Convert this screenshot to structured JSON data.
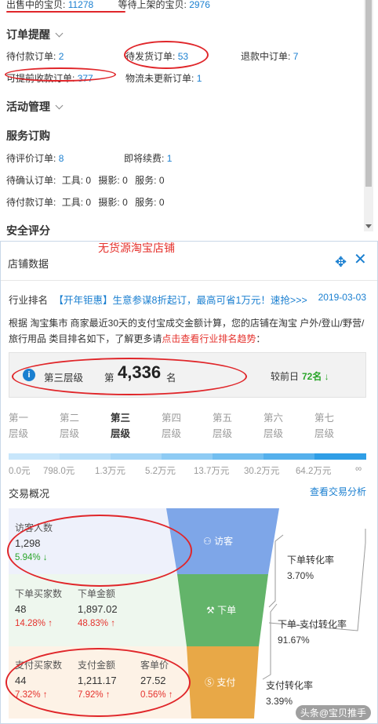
{
  "top": {
    "on_sale_label": "出售中的宝贝:",
    "on_sale_value": "11278",
    "waiting_label": "等待上架的宝贝:",
    "waiting_value": "2976",
    "order_section": "订单提醒",
    "pending_pay_label": "待付款订单:",
    "pending_pay_value": "2",
    "to_ship_label": "待发货订单:",
    "to_ship_value": "53",
    "refund_label": "退款中订单:",
    "refund_value": "7",
    "early_recv_label": "可提前收款订单:",
    "early_recv_value": "377",
    "logistics_label": "物流未更新订单:",
    "logistics_value": "1",
    "activity_section": "活动管理",
    "service_section": "服务订购",
    "to_review_label": "待评价订单:",
    "to_review_value": "8",
    "renew_label": "即将续费:",
    "renew_value": "1",
    "confirm_label": "待确认订单:",
    "pay_label": "待付款订单:",
    "tool_label": "工具:",
    "tool_value": "0",
    "photo_label": "摄影:",
    "photo_value": "0",
    "service_label": "服务:",
    "service_value": "0",
    "security_section": "安全评分"
  },
  "store": {
    "title": "店铺数据",
    "watermark": "无货源淘宝店铺",
    "rank_head": "行业排名",
    "promo": "【开年钜惠】生意参谋8折起订，最高可省1万元！速抢>>>",
    "date": "2019-03-03",
    "desc_text": "根据 淘宝集市 商家最近30天的支付宝成交金额计算，您的店铺在淘宝 户外/登山/野营/旅行用品 类目排名如下，了解更多请",
    "desc_link": "点击查看行业排名趋势",
    "desc_end": "：",
    "level_name": "第三层级",
    "rank_pre": "第",
    "rank_num": "4,336",
    "rank_suf": "名",
    "prev_label": "较前日",
    "prev_value": "72名 ↓",
    "tiers": [
      "第一\n层级",
      "第二\n层级",
      "第三\n层级",
      "第四\n层级",
      "第五\n层级",
      "第六\n层级",
      "第七\n层级"
    ],
    "ticks": [
      "0.0元",
      "798.0元",
      "1.3万元",
      "5.2万元",
      "13.7万元",
      "30.2万元",
      "64.2万元",
      "∞"
    ],
    "bar_colors": [
      "#c8e6fb",
      "#b9dff9",
      "#a6d6f7",
      "#8ecbf4",
      "#72bef0",
      "#55b0ec",
      "#2f9ee6"
    ]
  },
  "trade": {
    "title": "交易概况",
    "link": "查看交易分析",
    "visitors_label": "访客人数",
    "visitors_value": "1,298",
    "visitors_pct": "5.94% ↓",
    "buyers_label": "下单买家数",
    "buyers_value": "48",
    "buyers_pct": "14.28% ↑",
    "order_amt_label": "下单金额",
    "order_amt_value": "1,897.02",
    "order_amt_pct": "48.83% ↑",
    "pay_buyers_label": "支付买家数",
    "pay_buyers_value": "44",
    "pay_buyers_pct": "7.32% ↑",
    "pay_amt_label": "支付金额",
    "pay_amt_value": "1,211.17",
    "pay_amt_pct": "7.92% ↑",
    "unit_price_label": "客单价",
    "unit_price_value": "27.52",
    "unit_price_pct": "0.56% ↑",
    "funnel_visit": "访客",
    "funnel_order": "下单",
    "funnel_pay": "支付",
    "conv_order_label": "下单转化率",
    "conv_order_value": "3.70%",
    "conv_orderpay_label": "下单-支付转化率",
    "conv_orderpay_value": "91.67%",
    "conv_pay_label": "支付转化率",
    "conv_pay_value": "3.39%",
    "watermark": "头条@宝贝推手"
  }
}
